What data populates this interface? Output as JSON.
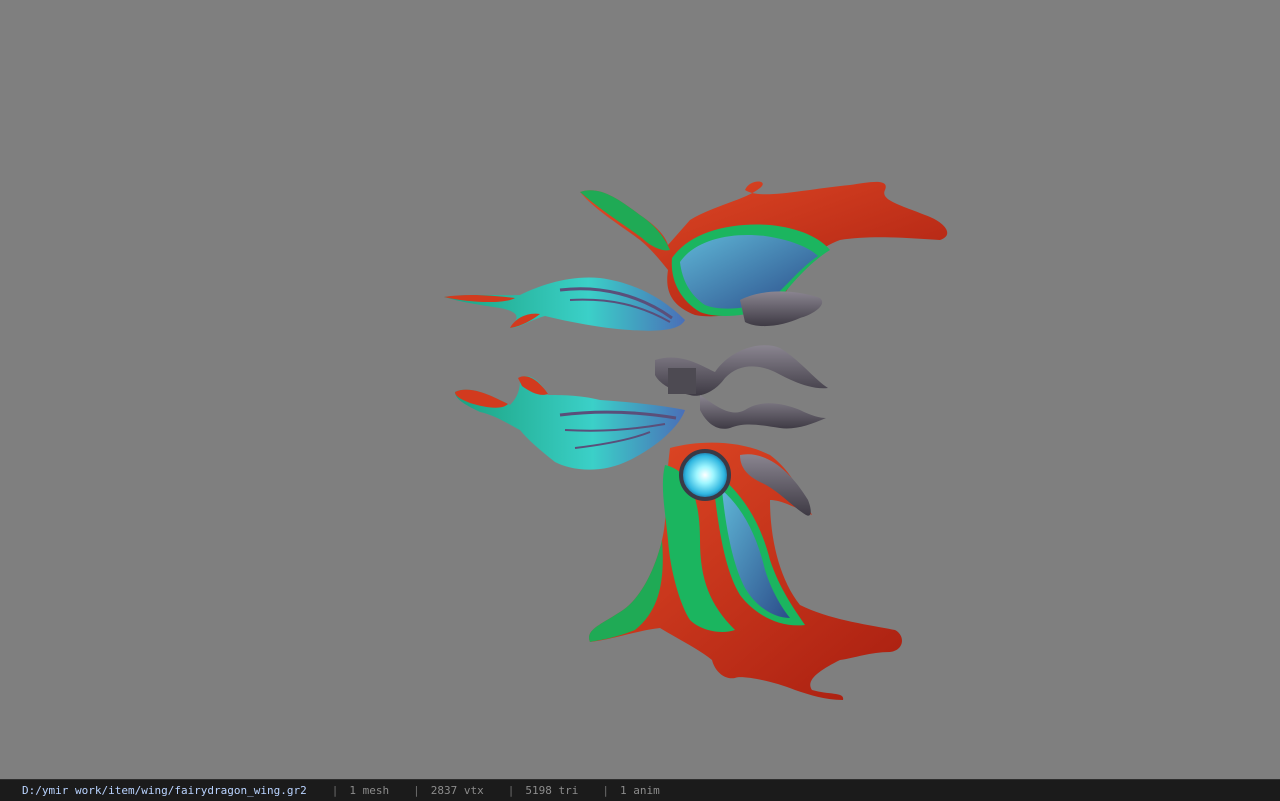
{
  "viewer": {
    "file_path": "D:/ymir work/item/wing/fairydragon_wing.gr2",
    "stats": {
      "mesh": "1 mesh",
      "vertices": "2837 vtx",
      "triangles": "5198 tri",
      "animations": "1 anim"
    },
    "separator": "|"
  },
  "colors": {
    "background": "#7f7f7f",
    "statusbar": "#1b1b1b",
    "path_text": "#b9d3ff",
    "wing_red": "#d2341a",
    "wing_green": "#1bb55f",
    "wing_blue": "#3f7fa8",
    "metal": "#5e5a63",
    "orb": "#8ff2ff"
  }
}
